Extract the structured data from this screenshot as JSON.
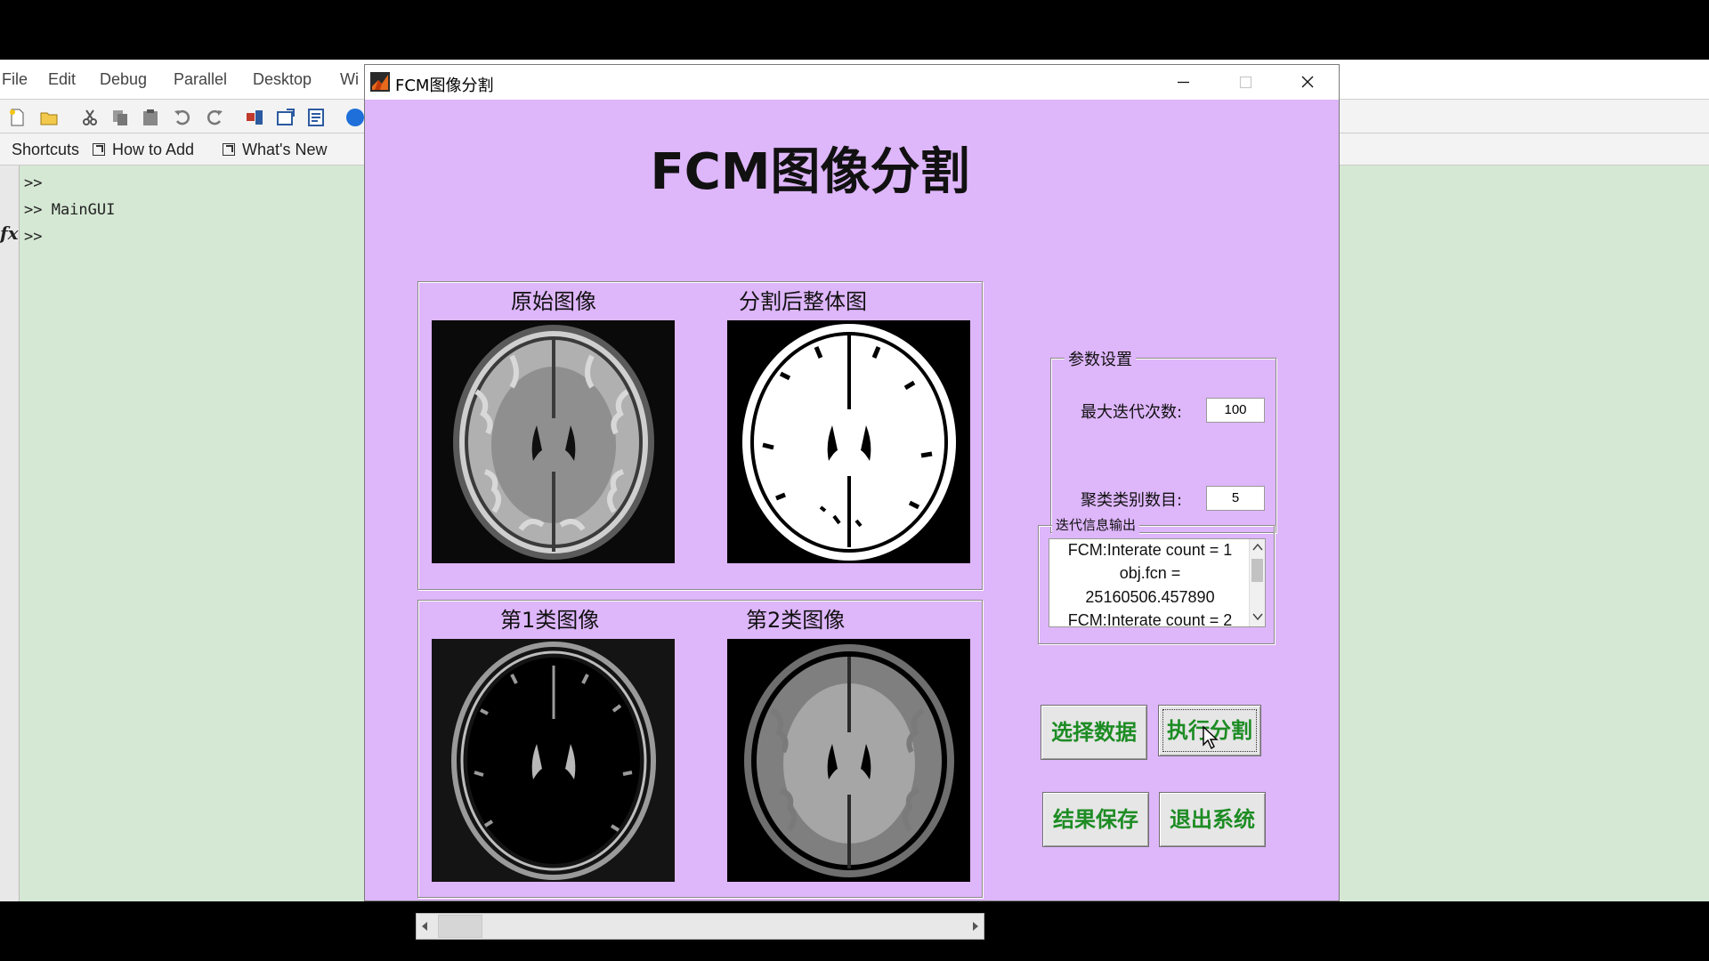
{
  "matlab": {
    "menus": [
      "File",
      "Edit",
      "Debug",
      "Parallel",
      "Desktop",
      "Wi"
    ],
    "shortcuts": [
      "Shortcuts",
      "How to Add",
      "What's New"
    ],
    "command_lines": [
      ">>",
      ">> MainGUI",
      ">>"
    ],
    "fx_label": "fx"
  },
  "window": {
    "title": "FCM图像分割",
    "minimize_icon": "minimize-icon",
    "maximize_icon": "maximize-icon",
    "close_icon": "close-icon"
  },
  "main_title": "FCM图像分割",
  "images": {
    "original_label": "原始图像",
    "segmented_label": "分割后整体图",
    "class1_label": "第1类图像",
    "class2_label": "第2类图像"
  },
  "params": {
    "group_title": "参数设置",
    "max_iter_label": "最大迭代次数:",
    "max_iter_value": "100",
    "clusters_label": "聚类类别数目:",
    "clusters_value": "5"
  },
  "iteration_output": {
    "group_title": "迭代信息输出",
    "lines": [
      "FCM:Interate count = 1",
      "obj.fcn =",
      "25160506.457890",
      "FCM:Interate count = 2"
    ]
  },
  "buttons": {
    "select_data": "选择数据",
    "run_segmentation": "执行分割",
    "save_result": "结果保存",
    "exit_system": "退出系统"
  },
  "colors": {
    "window_bg": "#deb6fa",
    "button_text": "#1d8c24",
    "matlab_bg": "#d5e8d4"
  }
}
